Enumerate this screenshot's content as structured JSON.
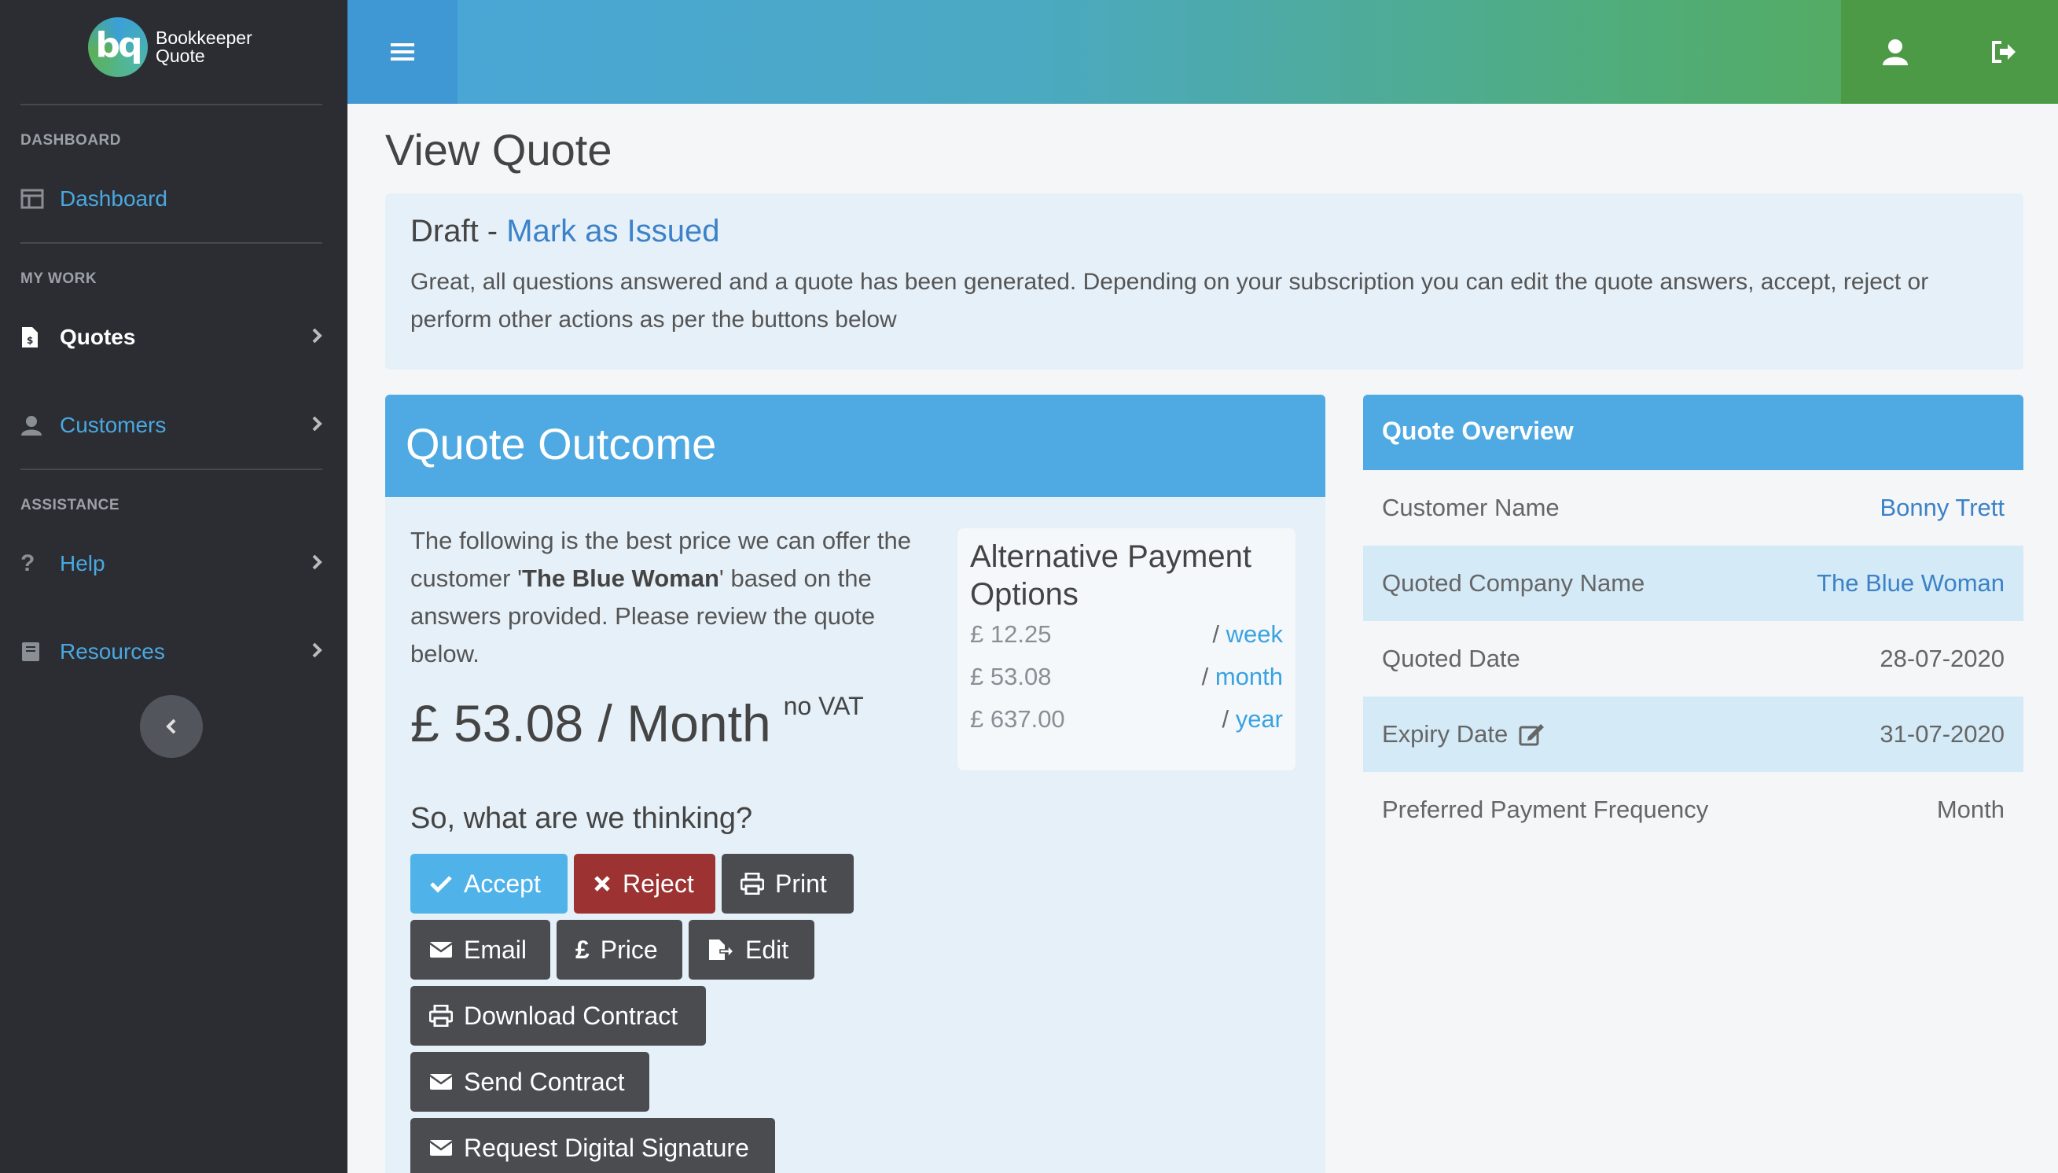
{
  "brand": {
    "line1": "Bookkeeper",
    "line2": "Quote",
    "logo_text": "bq"
  },
  "sidebar": {
    "sections": [
      {
        "heading": "DASHBOARD"
      },
      {
        "heading": "MY WORK"
      },
      {
        "heading": "ASSISTANCE"
      }
    ],
    "items": [
      {
        "label": "Dashboard",
        "icon": "dashboard-icon"
      },
      {
        "label": "Quotes",
        "icon": "quote-file-icon",
        "active": true
      },
      {
        "label": "Customers",
        "icon": "user-icon"
      },
      {
        "label": "Help",
        "icon": "question-icon"
      },
      {
        "label": "Resources",
        "icon": "book-icon"
      }
    ]
  },
  "topbar": {
    "menu_icon": "hamburger-icon",
    "profile_icon": "user-icon",
    "logout_icon": "logout-icon"
  },
  "page": {
    "title": "View Quote"
  },
  "draft": {
    "status": "Draft - ",
    "action_link": "Mark as Issued",
    "message": "Great, all questions answered and a quote has been generated. Depending on your subscription you can edit the quote answers, accept, reject or perform other actions as per the buttons below"
  },
  "outcome": {
    "title": "Quote Outcome",
    "intro_before": "The following is the best price we can offer the customer '",
    "intro_company": "The Blue Woman",
    "intro_after": "' based on the answers provided. Please review the quote below.",
    "price": "£ 53.08 / Month",
    "vat_note": "no VAT",
    "alt_title": "Alternative Payment Options",
    "alt_options": [
      {
        "amount": "£ 12.25",
        "period": "week"
      },
      {
        "amount": "£ 53.08",
        "period": "month"
      },
      {
        "amount": "£ 637.00",
        "period": "year"
      }
    ],
    "thinking": "So, what are we thinking?",
    "buttons": {
      "accept": "Accept",
      "reject": "Reject",
      "print": "Print",
      "email": "Email",
      "price": "Price",
      "edit": "Edit",
      "download_contract": "Download Contract",
      "send_contract": "Send Contract",
      "request_signature": "Request Digital Signature"
    }
  },
  "overview": {
    "title": "Quote Overview",
    "rows": [
      {
        "label": "Customer Name",
        "value": "Bonny Trett"
      },
      {
        "label": "Quoted Company Name",
        "value": "The Blue Woman"
      },
      {
        "label": "Quoted Date",
        "value": "28-07-2020"
      },
      {
        "label": "Expiry Date",
        "value": "31-07-2020"
      },
      {
        "label": "Preferred Payment Frequency",
        "value": "Month"
      }
    ]
  },
  "colors": {
    "sidebar_bg": "#2b2d33",
    "accent_blue": "#4fa9e2",
    "link_blue": "#3b82c8",
    "reject_red": "#9c3232",
    "dark_button": "#4a4c50"
  }
}
